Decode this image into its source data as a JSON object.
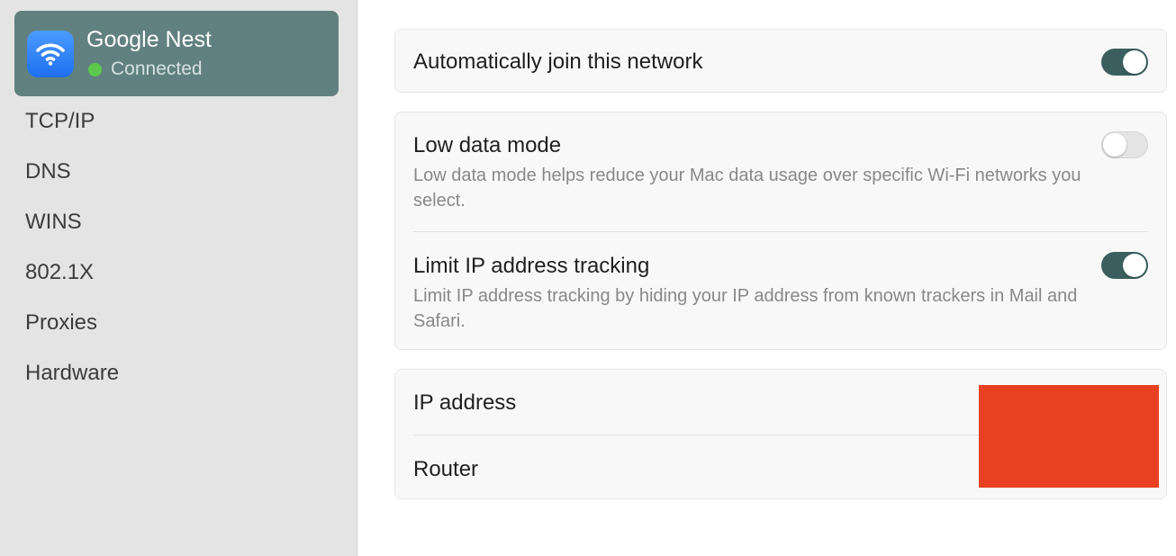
{
  "sidebar": {
    "network": {
      "name": "Google Nest",
      "status": "Connected",
      "status_color": "#5cc84d",
      "icon": "wifi-icon"
    },
    "items": [
      {
        "label": "TCP/IP"
      },
      {
        "label": "DNS"
      },
      {
        "label": "WINS"
      },
      {
        "label": "802.1X"
      },
      {
        "label": "Proxies"
      },
      {
        "label": "Hardware"
      }
    ]
  },
  "settings": {
    "auto_join": {
      "label": "Automatically join this network",
      "enabled": true
    },
    "low_data": {
      "label": "Low data mode",
      "description": "Low data mode helps reduce your Mac data usage over specific Wi-Fi networks you select.",
      "enabled": false
    },
    "limit_ip": {
      "label": "Limit IP address tracking",
      "description": "Limit IP address tracking by hiding your IP address from known trackers in Mail and Safari.",
      "enabled": true
    }
  },
  "info": {
    "ip_label": "IP address",
    "router_label": "Router"
  },
  "colors": {
    "toggle_on": "#3b5f5f",
    "selected_card": "#618180",
    "redaction": "#e84023"
  }
}
